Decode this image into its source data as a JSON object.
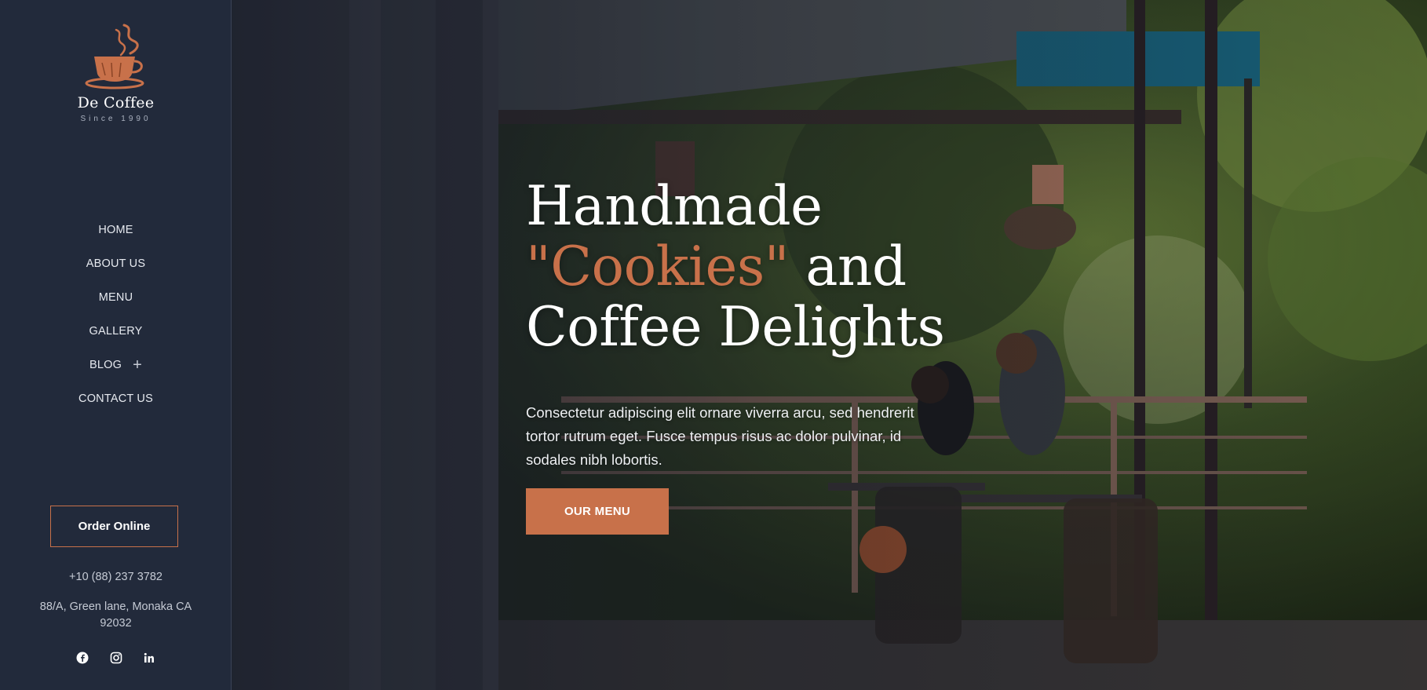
{
  "brand": {
    "name": "De Coffee",
    "tagline": "Since 1990"
  },
  "nav": {
    "items": [
      {
        "label": "HOME"
      },
      {
        "label": "ABOUT US"
      },
      {
        "label": "MENU"
      },
      {
        "label": "GALLERY"
      },
      {
        "label": "BLOG",
        "has_submenu": true,
        "submenu_icon": "plus-icon"
      },
      {
        "label": "CONTACT US"
      }
    ]
  },
  "sidebar": {
    "order_button": "Order Online",
    "phone": "+10 (88) 237 3782",
    "address": "88/A, Green lane, Monaka CA 92032",
    "social": [
      "facebook-icon",
      "instagram-icon",
      "linkedin-icon"
    ]
  },
  "hero": {
    "headline_line1": "Handmade",
    "headline_accent": "\"Cookies\"",
    "headline_after_accent": " and",
    "headline_line3": "Coffee Delights",
    "intro": "Consectetur adipiscing elit ornare viverra arcu, sed hendrerit tortor rutrum eget. Fusce tempus risus ac dolor pulvinar, id sodales nibh lobortis.",
    "cta_label": "OUR MENU"
  },
  "colors": {
    "accent": "#c8714a",
    "sidebar_bg": "#222a3b",
    "text_light": "#ffffff"
  }
}
